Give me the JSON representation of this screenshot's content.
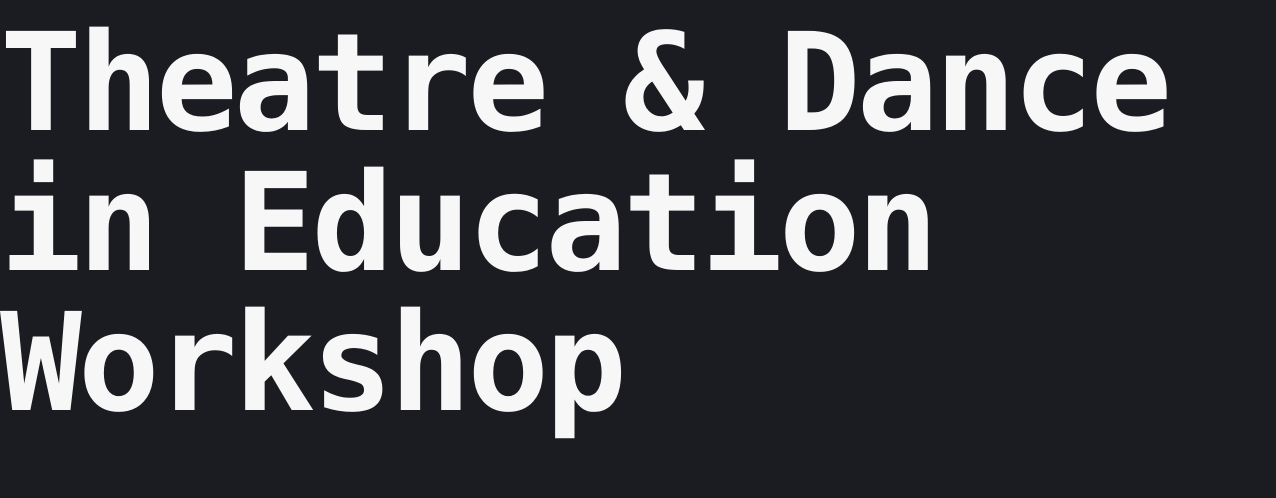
{
  "hero": {
    "title_lines": [
      "Theatre & Dance",
      "in Education",
      "Workshop"
    ]
  },
  "colors": {
    "background": "#1b1c21",
    "text": "#f7f7f7"
  }
}
